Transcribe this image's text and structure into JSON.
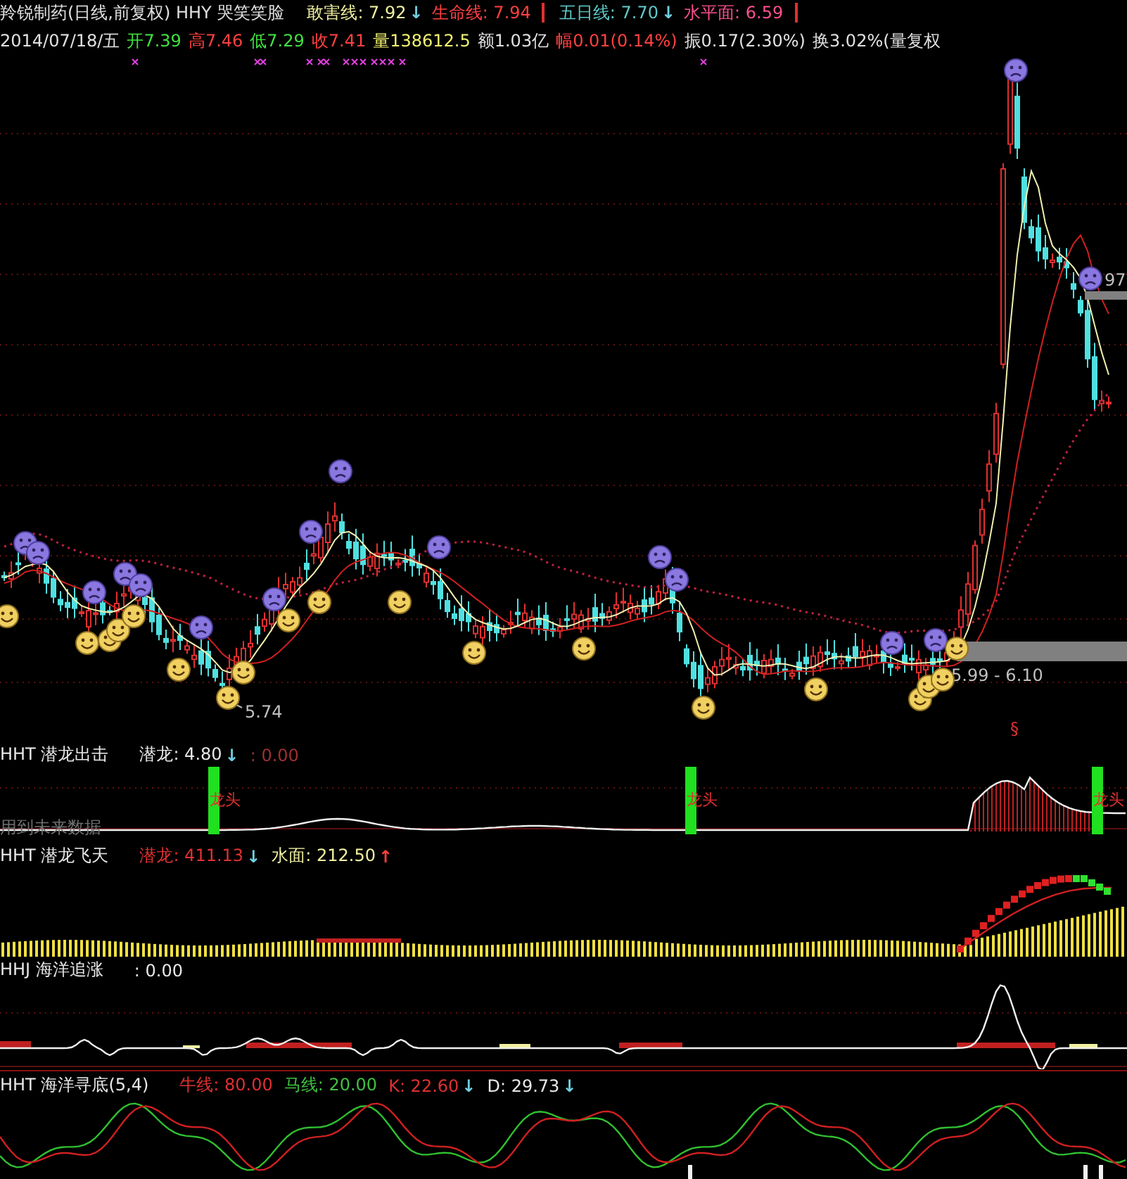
{
  "header": {
    "title": "羚锐制药(日线,前复权) HHY 哭笑笑脸",
    "indicators": [
      {
        "kind": "value",
        "text": "敢害线: 7.92",
        "color": "#f0f0a0",
        "separator": false
      },
      {
        "kind": "arrow",
        "text": "↓",
        "color": "#70d0e0"
      },
      {
        "kind": "value",
        "text": "生命线: 7.94",
        "color": "#ff4040",
        "separator": true
      },
      {
        "kind": "value",
        "text": "五日线: 7.70",
        "color": "#60c8c8",
        "separator": false
      },
      {
        "kind": "arrow",
        "text": "↓",
        "color": "#70d0e0"
      },
      {
        "kind": "value",
        "text": "水平面: 6.59",
        "color": "#ff5090",
        "separator": true
      }
    ]
  },
  "quote": {
    "items": [
      {
        "text": "2014/07/18/五",
        "color": "#e0e0e0"
      },
      {
        "text": "开7.39",
        "color": "#40e040"
      },
      {
        "text": "高7.46",
        "color": "#ff4040"
      },
      {
        "text": "低7.29",
        "color": "#40e040"
      },
      {
        "text": "收7.41",
        "color": "#ff4040"
      },
      {
        "text": "量138612.5",
        "color": "#f0f070"
      },
      {
        "text": "额1.03亿",
        "color": "#e0e0e0"
      },
      {
        "text": "幅0.01(0.14%)",
        "color": "#ff4040"
      },
      {
        "text": "振0.17(2.30%)",
        "color": "#e0e0e0"
      },
      {
        "text": "换3.02%(量复权",
        "color": "#e0e0e0"
      }
    ]
  },
  "chart": {
    "labels": [
      {
        "text": "5.74",
        "kind": "low"
      },
      {
        "text": "5.99 - 6.10",
        "kind": "band"
      },
      {
        "text": "97",
        "kind": "high"
      },
      {
        "text": "§",
        "kind": "mark"
      }
    ]
  },
  "panels": [
    {
      "kind": "signal",
      "title": "HHT 潜龙出击",
      "readings": [
        {
          "kind": "value",
          "text": "潜龙: 4.80",
          "color": "#e8e8e8"
        },
        {
          "kind": "arrow",
          "text": "↓",
          "color": "#70d0e0"
        },
        {
          "kind": "value",
          "text": ": 0.00",
          "color": "#a03030"
        }
      ],
      "signals": [
        "龙头",
        "龙头",
        "龙头"
      ],
      "note": "用到未来数据"
    },
    {
      "kind": "volume",
      "title": "HHT 潜龙飞天",
      "readings": [
        {
          "kind": "value",
          "text": "潜龙: 411.13",
          "color": "#e03030"
        },
        {
          "kind": "arrow",
          "text": "↓",
          "color": "#70d0e0"
        },
        {
          "kind": "value",
          "text": "水面: 212.50",
          "color": "#f0f0a0"
        },
        {
          "kind": "arrow",
          "text": "↑",
          "color": "#ff4040"
        }
      ]
    },
    {
      "kind": "wave",
      "title": "HHJ 海洋追涨",
      "readings": [
        {
          "kind": "value",
          "text": ": 0.00",
          "color": "#e8e8e8"
        }
      ]
    },
    {
      "kind": "oscillator",
      "title": "HHT 海洋寻底(5,4)",
      "readings": [
        {
          "kind": "value",
          "text": "牛线: 80.00",
          "color": "#e03030"
        },
        {
          "kind": "value",
          "text": "马线: 20.00",
          "color": "#40c040"
        },
        {
          "kind": "value",
          "text": "K: 22.60",
          "color": "#e03030"
        },
        {
          "kind": "arrow",
          "text": "↓",
          "color": "#70d0e0"
        },
        {
          "kind": "value",
          "text": "D: 29.73",
          "color": "#e8e8e8"
        },
        {
          "kind": "arrow",
          "text": "↓",
          "color": "#70d0e0"
        }
      ]
    }
  ]
}
